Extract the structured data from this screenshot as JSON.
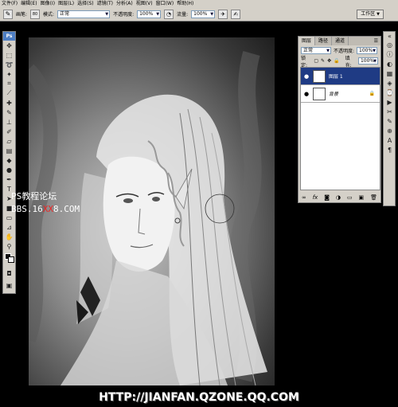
{
  "menubar": {
    "items": [
      "文件(F)",
      "编辑(E)",
      "图像(I)",
      "图层(L)",
      "选择(S)",
      "滤镜(T)",
      "分析(A)",
      "视图(V)",
      "窗口(W)",
      "帮助(H)"
    ]
  },
  "options": {
    "brush_label": "画笔:",
    "brush_size": "80",
    "mode_label": "模式:",
    "mode_value": "正常",
    "opacity_label": "不透明度:",
    "opacity_value": "100%",
    "flow_label": "流量:",
    "flow_value": "100%",
    "workspace_label": "工作区"
  },
  "toolbox": {
    "logo": "Ps",
    "tools": [
      "move-icon",
      "marquee-icon",
      "lasso-icon",
      "wand-icon",
      "crop-icon",
      "slice-icon",
      "healing-icon",
      "brush-icon",
      "stamp-icon",
      "history-brush-icon",
      "eraser-icon",
      "gradient-icon",
      "blur-icon",
      "dodge-icon",
      "pen-icon",
      "text-icon",
      "path-select-icon",
      "shape-icon",
      "notes-icon",
      "eyedropper-icon",
      "hand-icon",
      "zoom-icon"
    ]
  },
  "watermark": {
    "line1": "PS教程论坛",
    "line2_pre": "BBS.16",
    "line2_red": "XX",
    "line2_post": "8.COM"
  },
  "layers_panel": {
    "tabs": [
      "图层",
      "路径",
      "通道"
    ],
    "blend_mode": "正常",
    "opacity_label": "不透明度:",
    "opacity_value": "100%",
    "lock_label": "锁定:",
    "fill_label": "填充:",
    "fill_value": "100%",
    "layers": [
      {
        "name": "图层 1",
        "selected": true
      },
      {
        "name": "背景",
        "selected": false
      }
    ],
    "footer_icons": [
      "link-icon",
      "fx-icon",
      "mask-icon",
      "adjustment-icon",
      "group-icon",
      "new-layer-icon",
      "trash-icon"
    ]
  },
  "banner": {
    "text": "HTTP://JIANFAN.QZONE.QQ.COM"
  },
  "colors": {
    "ui_gray": "#d4d0c8",
    "selection_blue": "#1f3b84",
    "watermark_red": "#ee2222"
  }
}
